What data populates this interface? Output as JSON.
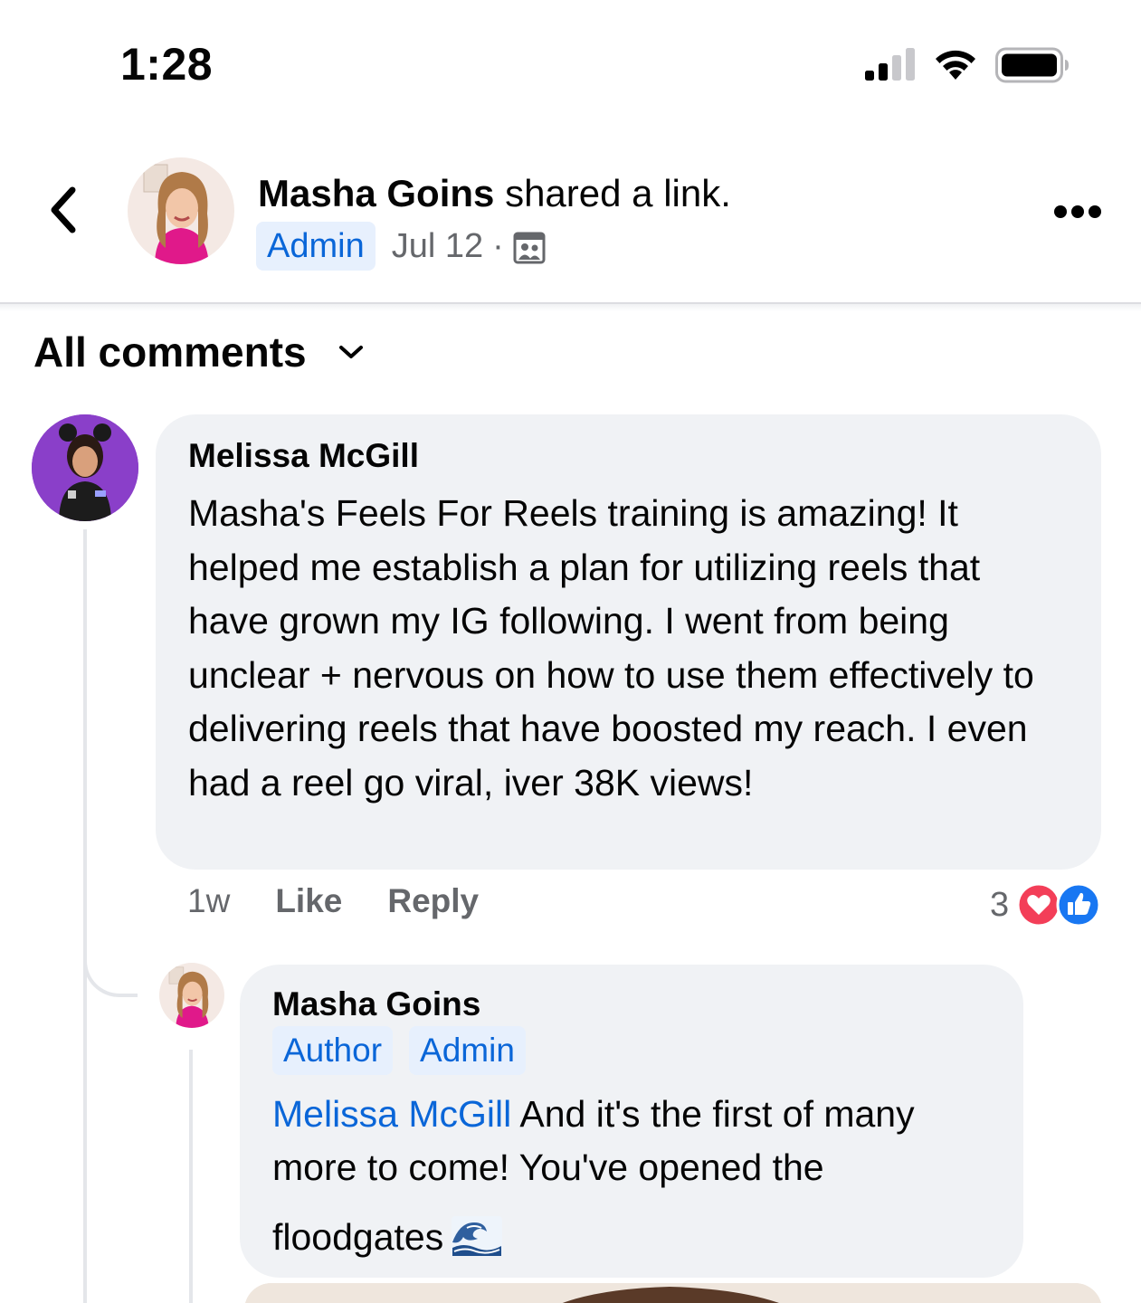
{
  "status_bar": {
    "time": "1:28"
  },
  "post_header": {
    "author": "Masha Goins",
    "action": " shared a link.",
    "badge": "Admin",
    "date": "Jul 12",
    "separator": "·"
  },
  "comments_filter": {
    "label": "All comments"
  },
  "comment": {
    "author": "Melissa McGill",
    "text": "Masha's Feels For Reels training is amazing!  It helped me establish a plan for utilizing reels that have grown my IG following.  I went from being unclear + nervous on how to use them effectively to delivering reels that have boosted my reach.  I even had a reel go viral, iver 38K views!",
    "time": "1w",
    "like_label": "Like",
    "reply_label": "Reply",
    "reaction_count": "3"
  },
  "reply": {
    "author": "Masha Goins",
    "badges": [
      "Author",
      "Admin"
    ],
    "mention": "Melissa McGill",
    "text": " And it's the first of many more to come! You've opened the",
    "text_last": "floodgates"
  },
  "colors": {
    "link_blue": "#0a66d8",
    "badge_bg": "#e7f0fd",
    "bubble_bg": "#f0f2f5",
    "secondary_text": "#65676b",
    "love_red": "#f33e58",
    "like_blue": "#1877f2"
  }
}
